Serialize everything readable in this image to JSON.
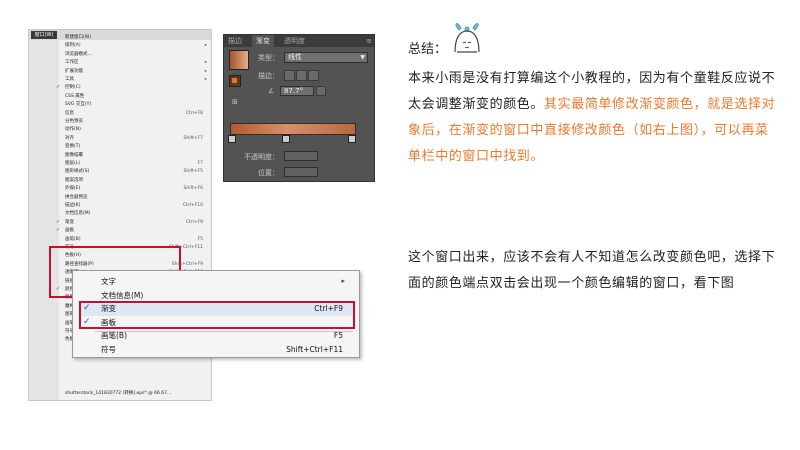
{
  "menu_screenshot": {
    "title": "窗口(W)",
    "items": [
      {
        "label": "新建窗口(W)",
        "shortcut": ""
      },
      {
        "label": "排列(A)",
        "shortcut": "",
        "arrow": "▸"
      },
      {
        "label": "浏览器模式…",
        "shortcut": ""
      },
      {
        "label": "工作区",
        "shortcut": "",
        "arrow": "▸"
      },
      {
        "label": "扩展功能",
        "shortcut": "",
        "arrow": "▸"
      },
      {
        "label": "工具",
        "shortcut": "",
        "arrow": "▸"
      },
      {
        "label": "控制(C)",
        "shortcut": "",
        "check": "✓"
      },
      {
        "label": "CSS 属性",
        "shortcut": ""
      },
      {
        "label": "SVG 交互(Y)",
        "shortcut": ""
      },
      {
        "label": "信息",
        "shortcut": "Ctrl+F8"
      },
      {
        "label": "分色预览",
        "shortcut": ""
      },
      {
        "label": "动作(N)",
        "shortcut": ""
      },
      {
        "label": "对齐",
        "shortcut": "Shift+F7"
      },
      {
        "label": "变换(T)",
        "shortcut": ""
      },
      {
        "label": "图像描摹",
        "shortcut": ""
      },
      {
        "label": "图层(L)",
        "shortcut": "F7"
      },
      {
        "label": "图形样式(S)",
        "shortcut": "Shift+F5"
      },
      {
        "label": "图案选项",
        "shortcut": ""
      },
      {
        "label": "外观(E)",
        "shortcut": "Shift+F6"
      },
      {
        "label": "拼合器预览",
        "shortcut": ""
      },
      {
        "label": "描边(K)",
        "shortcut": "Ctrl+F10"
      },
      {
        "label": "文档信息(M)",
        "shortcut": ""
      },
      {
        "label": "渐变",
        "shortcut": "Ctrl+F9",
        "check": "✓"
      },
      {
        "label": "画板",
        "shortcut": "",
        "check": "✓"
      },
      {
        "label": "画笔(B)",
        "shortcut": "F5"
      },
      {
        "label": "符号",
        "shortcut": "Shift+Ctrl+F11"
      },
      {
        "label": "色板(H)",
        "shortcut": ""
      },
      {
        "label": "路径查找器(P)",
        "shortcut": "Shift+Ctrl+F9"
      },
      {
        "label": "透明度",
        "shortcut": "Shift+Ctrl+F10"
      },
      {
        "label": "链接(I)",
        "shortcut": ""
      },
      {
        "label": "颜色",
        "shortcut": "F6",
        "check": "✓"
      },
      {
        "label": "颜色参考",
        "shortcut": "Shift+F3"
      },
      {
        "label": "魔棒",
        "shortcut": ""
      },
      {
        "label": "图形样式库",
        "shortcut": "",
        "arrow": "▸"
      },
      {
        "label": "画笔库",
        "shortcut": "",
        "arrow": "▸"
      },
      {
        "label": "符号库",
        "shortcut": "",
        "arrow": "▸"
      },
      {
        "label": "色板库",
        "shortcut": "",
        "arrow": "▸"
      }
    ],
    "footer": "shutterstock_141830772 [转换].eps* @ 66.67…",
    "zoom_items": [
      {
        "label": "文字",
        "shortcut": "",
        "arrow": "▸"
      },
      {
        "label": "文档信息(M)",
        "shortcut": ""
      },
      {
        "label": "渐变",
        "shortcut": "Ctrl+F9",
        "check": "✓"
      },
      {
        "label": "画板",
        "shortcut": "",
        "check": "✓"
      },
      {
        "label": "画笔(B)",
        "shortcut": "F5"
      },
      {
        "label": "符号",
        "shortcut": "Shift+Ctrl+F11"
      }
    ]
  },
  "gradient_panel": {
    "tabs": [
      "描边",
      "渐变",
      "透明度"
    ],
    "menu_icon": "≡",
    "type_label": "类型：",
    "type_value": "线性",
    "stroke_label": "描边：",
    "angle_value": "87.7°",
    "opacity_label": "不透明度：",
    "location_label": "位置："
  },
  "notes": {
    "heading": "总结：",
    "p1_normal": "本来小雨是没有打算编这个小教程的，因为有个童鞋反应说不太会调整渐变的颜色。",
    "p1_orange": "其实最简单修改渐变颜色，就是选择对象后，在渐变的窗口中直接修改颜色（如右上图），可以再菜单栏中的窗口中找到。",
    "p2": "这个窗口出来，应该不会有人不知道怎么改变颜色吧，选择下面的颜色端点双击会出现一个颜色编辑的窗口，看下图",
    "accent_color": "#ea7a2c"
  }
}
